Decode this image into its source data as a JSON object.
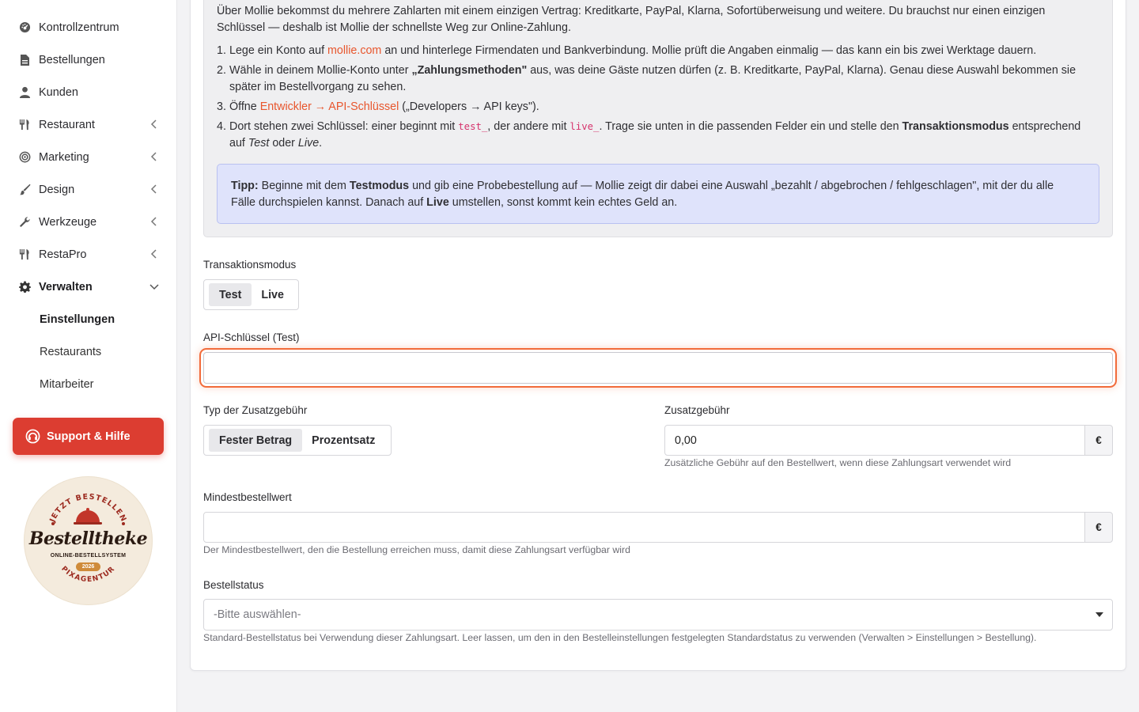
{
  "sidebar": {
    "items": [
      {
        "label": "Kontrollzentrum",
        "icon": "dashboard-icon"
      },
      {
        "label": "Bestellungen",
        "icon": "document-icon"
      },
      {
        "label": "Kunden",
        "icon": "user-icon"
      },
      {
        "label": "Restaurant",
        "icon": "cutlery-icon"
      },
      {
        "label": "Marketing",
        "icon": "target-icon"
      },
      {
        "label": "Design",
        "icon": "brush-icon"
      },
      {
        "label": "Werkzeuge",
        "icon": "wrench-icon"
      },
      {
        "label": "RestaPro",
        "icon": "cutlery-icon"
      },
      {
        "label": "Verwalten",
        "icon": "gear-icon"
      }
    ],
    "subitems": [
      {
        "label": "Einstellungen"
      },
      {
        "label": "Restaurants"
      },
      {
        "label": "Mitarbeiter"
      }
    ],
    "support_label": "Support & Hilfe",
    "badge": {
      "top_text": "JETZT BESTELLEN",
      "title": "Bestelltheke",
      "subtitle": "ONLINE-BESTELLSYSTEM",
      "year": "2026",
      "bottom_text": "PIXAGENTUR"
    }
  },
  "info": {
    "intro_1": "Über Mollie bekommst du mehrere Zahlarten mit einem einzigen Vertrag: Kreditkarte, PayPal, Klarna, Sofortüberweisung und weitere. Du brauchst nur einen einzigen",
    "intro_2": "Schlüssel — deshalb ist Mollie der schnellste Weg zur Online-Zahlung.",
    "step1_a": "Lege ein Konto auf ",
    "step1_link": "mollie.com",
    "step1_b": " an und hinterlege Firmendaten und Bankverbindung. Mollie prüft die Angaben einmalig — das kann ein bis zwei Werktage dauern.",
    "step2_a": "Wähle in deinem Mollie-Konto unter ",
    "step2_bold": "„Zahlungsmethoden\"",
    "step2_b": " aus, was deine Gäste nutzen dürfen (z. B. Kreditkarte, PayPal, Klarna). Genau diese Auswahl bekommen sie",
    "step2_c": "später im Bestellvorgang zu sehen.",
    "step3_a": "Öffne ",
    "step3_link": "Entwickler → API-Schlüssel",
    "step3_b": " („Developers → API keys\").",
    "step4_a": "Dort stehen zwei Schlüssel: einer beginnt mit ",
    "step4_code1": "test_",
    "step4_b": ", der andere mit ",
    "step4_code2": "live_",
    "step4_c": ". Trage sie unten in die passenden Felder ein und stelle den ",
    "step4_bold": "Transaktionsmodus",
    "step4_d": " entsprechend",
    "step4_e1": "auf ",
    "step4_e_test": "Test",
    "step4_e_oder": " oder ",
    "step4_e_live": "Live",
    "step4_e_end": ".",
    "tip_label": "Tipp:",
    "tip_a": " Beginne mit dem ",
    "tip_bold1": "Testmodus",
    "tip_b": " und gib eine Probebestellung auf — Mollie zeigt dir dabei eine Auswahl „bezahlt / abgebrochen / fehlgeschlagen\", mit der du alle",
    "tip_c": "Fälle durchspielen kannst. Danach auf ",
    "tip_bold2": "Live",
    "tip_d": " umstellen, sonst kommt kein echtes Geld an."
  },
  "form": {
    "mode_label": "Transaktionsmodus",
    "mode_options": [
      "Test",
      "Live"
    ],
    "api_label": "API-Schlüssel (Test)",
    "api_value": "",
    "fee_type_label": "Typ der Zusatzgebühr",
    "fee_type_options": [
      "Fester Betrag",
      "Prozentsatz"
    ],
    "fee_label": "Zusatzgebühr",
    "fee_value": "0,00",
    "currency": "€",
    "fee_help": "Zusätzliche Gebühr auf den Bestellwert, wenn diese Zahlungsart verwendet wird",
    "min_label": "Mindestbestellwert",
    "min_value": "",
    "min_help": "Der Mindestbestellwert, den die Bestellung erreichen muss, damit diese Zahlungsart verfügbar wird",
    "status_label": "Bestellstatus",
    "status_placeholder": "-Bitte auswählen-",
    "status_help": "Standard-Bestellstatus bei Verwendung dieser Zahlungsart. Leer lassen, um den in den Bestelleinstellungen festgelegten Standardstatus zu verwenden (Verwalten > Einstellungen > Bestellung)."
  },
  "colors": {
    "accent": "#e8562d",
    "support": "#dc3d31",
    "focus_ring": "#f26b3a",
    "tip_bg": "#dfe3fb"
  }
}
